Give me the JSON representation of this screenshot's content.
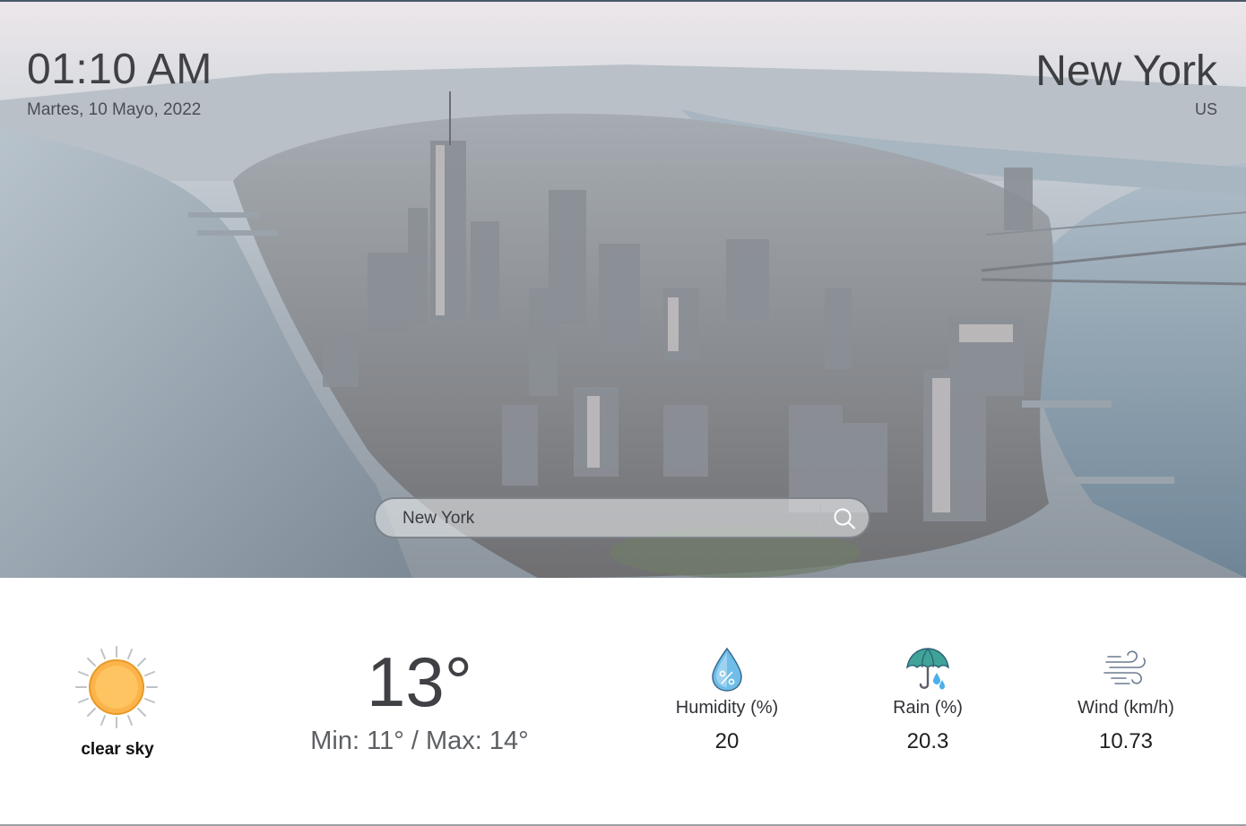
{
  "header": {
    "time": "01:10 AM",
    "date": "Martes, 10 Mayo, 2022",
    "city": "New York",
    "country": "US"
  },
  "search": {
    "value": "New York",
    "icon": "search-icon"
  },
  "current": {
    "condition": "clear sky",
    "condition_icon": "sun-icon",
    "temperature": "13°",
    "min_max": "Min: 11° / Max: 14°"
  },
  "metrics": [
    {
      "label": "Humidity (%)",
      "value": "20",
      "icon": "humidity-drop-icon"
    },
    {
      "label": "Rain (%)",
      "value": "20.3",
      "icon": "umbrella-rain-icon"
    },
    {
      "label": "Wind (km/h)",
      "value": "10.73",
      "icon": "wind-icon"
    }
  ],
  "colors": {
    "sun": "#fbb34a",
    "water": "#7f98ab",
    "text_dark": "#3f4144"
  }
}
